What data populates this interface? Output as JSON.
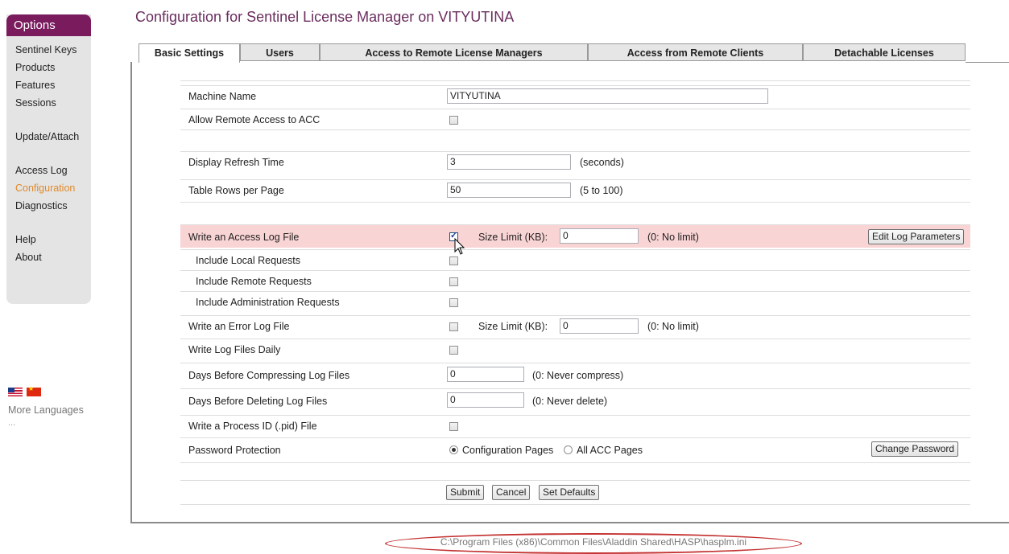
{
  "sidebar": {
    "header": "Options",
    "items": [
      {
        "label": "Sentinel Keys"
      },
      {
        "label": "Products"
      },
      {
        "label": "Features"
      },
      {
        "label": "Sessions"
      },
      {
        "label": "Update/Attach"
      },
      {
        "label": "Access Log"
      },
      {
        "label": "Configuration"
      },
      {
        "label": "Diagnostics"
      },
      {
        "label": "Help"
      },
      {
        "label": "About"
      }
    ],
    "more_languages": "More Languages",
    "more_dots": "..."
  },
  "page": {
    "title": "Configuration for Sentinel License Manager on VITYUTINA"
  },
  "tabs": [
    "Basic Settings",
    "Users",
    "Access to Remote License Managers",
    "Access from Remote Clients",
    "Detachable Licenses"
  ],
  "form": {
    "machine_name": {
      "label": "Machine Name",
      "value": "VITYUTINA"
    },
    "allow_remote": {
      "label": "Allow Remote Access to ACC",
      "checked": false
    },
    "refresh": {
      "label": "Display Refresh Time",
      "value": "3",
      "unit": "(seconds)"
    },
    "rows_per_page": {
      "label": "Table Rows per Page",
      "value": "50",
      "unit": "(5 to 100)"
    },
    "access_log": {
      "label": "Write an Access Log File",
      "checked": true,
      "size_label": "Size Limit (KB):",
      "size_value": "0",
      "size_note": "(0: No limit)",
      "edit_button": "Edit Log Parameters"
    },
    "include_local": {
      "label": "Include Local Requests",
      "checked": false
    },
    "include_remote": {
      "label": "Include Remote Requests",
      "checked": false
    },
    "include_admin": {
      "label": "Include Administration Requests",
      "checked": false
    },
    "error_log": {
      "label": "Write an Error Log File",
      "checked": false,
      "size_label": "Size Limit (KB):",
      "size_value": "0",
      "size_note": "(0: No limit)"
    },
    "daily": {
      "label": "Write Log Files Daily",
      "checked": false
    },
    "compress": {
      "label": "Days Before Compressing Log Files",
      "value": "0",
      "note": "(0: Never compress)"
    },
    "delete": {
      "label": "Days Before Deleting Log Files",
      "value": "0",
      "note": "(0: Never delete)"
    },
    "pid": {
      "label": "Write a Process ID (.pid) File",
      "checked": false
    },
    "password": {
      "label": "Password Protection",
      "option1": "Configuration Pages",
      "option2": "All ACC Pages",
      "selected": "Configuration Pages",
      "change_button": "Change Password"
    },
    "buttons": {
      "submit": "Submit",
      "cancel": "Cancel",
      "defaults": "Set Defaults"
    }
  },
  "footer": {
    "file_path": "C:\\Program Files (x86)\\Common Files\\Aladdin Shared\\HASP\\hasplm.ini"
  }
}
